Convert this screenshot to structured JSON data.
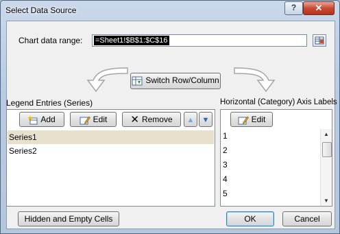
{
  "window": {
    "title": "Select Data Source",
    "help_label": "?",
    "close_label": "✕"
  },
  "range": {
    "label": "Chart data range:",
    "value": "=Sheet1!$B$1:$C$16"
  },
  "switch_button": {
    "label": "Switch Row/Column"
  },
  "legend": {
    "title": "Legend Entries (Series)",
    "add_label": "Add",
    "edit_label": "Edit",
    "remove_label": "Remove",
    "items": [
      "Series1",
      "Series2"
    ]
  },
  "axis": {
    "title": "Horizontal (Category) Axis Labels",
    "edit_label": "Edit",
    "items": [
      "1",
      "2",
      "3",
      "4",
      "5"
    ]
  },
  "footer": {
    "hidden_cells_label": "Hidden and Empty Cells",
    "ok_label": "OK",
    "cancel_label": "Cancel"
  },
  "colors": {
    "selected_row": "#e6e0cc",
    "close_button": "#c94a33",
    "title_bar": "#b8cbe2"
  }
}
